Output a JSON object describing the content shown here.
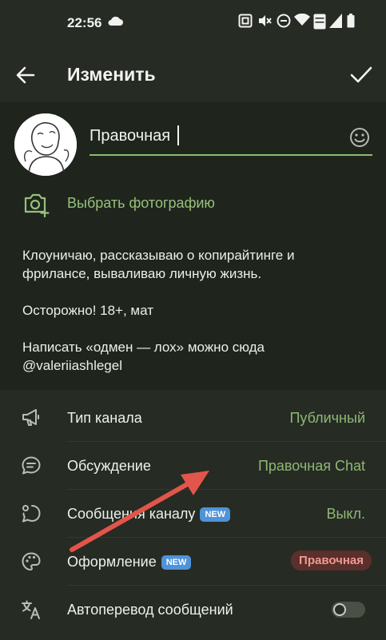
{
  "status_bar": {
    "time": "22:56",
    "icons": [
      "cloud-icon",
      "nfc-icon",
      "mute-icon",
      "dnd-icon",
      "wifi-icon",
      "volte-icon",
      "signal-icon",
      "battery-icon"
    ]
  },
  "app_bar": {
    "title": "Изменить",
    "back_icon": "arrow-left-icon",
    "confirm_icon": "check-icon"
  },
  "profile": {
    "name_value": "Правочная",
    "emoji_icon": "emoji-icon",
    "choose_photo_label": "Выбрать фотографию"
  },
  "description": {
    "line1": "Клоуничаю, рассказываю о копирайтинге и",
    "line2": "фрилансе, вываливаю личную жизнь.",
    "line3": "Осторожно! 18+, мат",
    "line4": "Написать «одмен — лох» можно сюда",
    "line5": "@valeriiashlegel"
  },
  "settings": [
    {
      "label": "Тип канала",
      "value": "Публичный",
      "icon": "megaphone-icon"
    },
    {
      "label": "Обсуждение",
      "value": "Правочная Chat",
      "icon": "chat-bubble-icon"
    },
    {
      "label": "Сообщения каналу",
      "badge": "NEW",
      "value": "Выкл.",
      "icon": "message-circle-icon"
    },
    {
      "label": "Оформление",
      "badge": "NEW",
      "value": "Правочная",
      "icon": "palette-icon"
    },
    {
      "label": "Автоперевод сообщений",
      "icon": "translate-icon",
      "toggle": false
    }
  ],
  "colors": {
    "background": "#262b24",
    "profile_background": "#1f251d",
    "accent_green": "#8fbb6c",
    "badge_blue": "#4f93d8",
    "pill_background": "#5a2f2c",
    "pill_text": "#f09a90",
    "annotation_arrow": "#e2554a"
  }
}
